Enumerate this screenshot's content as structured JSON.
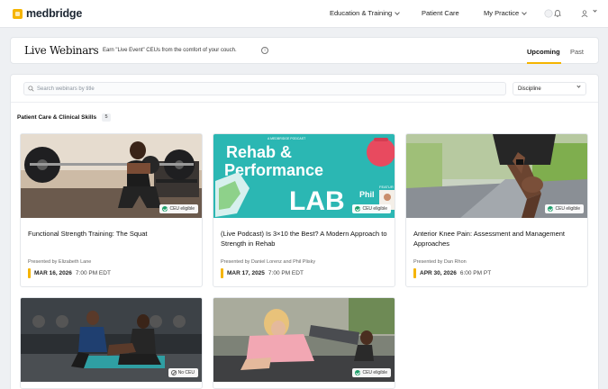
{
  "nav": {
    "logo": "medbridge",
    "education": "Education & Training",
    "patient_care": "Patient Care",
    "my_practice": "My Practice"
  },
  "header": {
    "title": "Live Webinars",
    "subtitle": "Earn \"Live Event\" CEUs from the comfort of your couch.",
    "tabs": [
      {
        "label": "Upcoming",
        "active": true
      },
      {
        "label": "Past",
        "active": false
      }
    ]
  },
  "filters": {
    "search_placeholder": "Search webinars by title",
    "discipline_label": "Discipline"
  },
  "section": {
    "title": "Patient Care & Clinical Skills",
    "count": "5"
  },
  "thumb_text": {
    "rehab": "Rehab &",
    "performance": "Performance",
    "lab": "LAB",
    "phil": "Phil",
    "featuring": "FEATUR",
    "podcast_tag": "A MEDBRIDGE PODCAST"
  },
  "webinars": [
    {
      "title": "Functional Strength Training: The Squat",
      "presenter": "Presented by Elizabeth Lane",
      "date": "MAR 16, 2026",
      "time": "7:00 PM EDT",
      "badge": "CEU eligible"
    },
    {
      "title": "(Live Podcast) Is 3×10 the Best? A Modern Approach to Strength in Rehab",
      "presenter": "Presented by Daniel Lorenz and Phil Plisky",
      "date": "MAR 17, 2025",
      "time": "7:00 PM EDT",
      "badge": "CEU eligible"
    },
    {
      "title": "Anterior Knee Pain: Assessment and Management Approaches",
      "presenter": "Presented by Dan Rhon",
      "date": "APR 30, 2026",
      "time": "6:00 PM PT",
      "badge": "CEU eligible"
    },
    {
      "badge": "No CEU"
    },
    {
      "badge": "CEU eligible"
    }
  ],
  "colors": {
    "accent": "#f5b400",
    "ceu_green": "#1e9e6a",
    "podcast_teal": "#2bb7b3"
  }
}
